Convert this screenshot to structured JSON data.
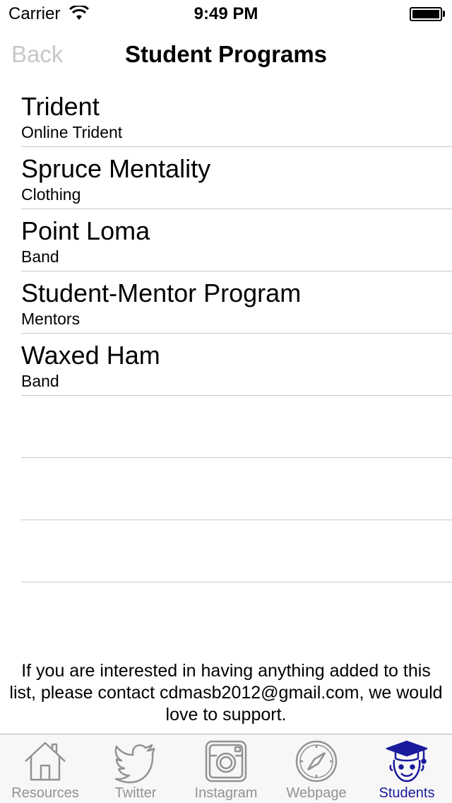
{
  "status_bar": {
    "carrier": "Carrier",
    "time": "9:49 PM",
    "battery_level": 1.0
  },
  "nav_bar": {
    "back_label": "Back",
    "title": "Student Programs"
  },
  "programs": [
    {
      "name": "Trident",
      "subtitle": "Online Trident"
    },
    {
      "name": "Spruce Mentality",
      "subtitle": "Clothing"
    },
    {
      "name": "Point Loma",
      "subtitle": "Band"
    },
    {
      "name": "Student-Mentor Program",
      "subtitle": "Mentors"
    },
    {
      "name": "Waxed Ham",
      "subtitle": "Band"
    }
  ],
  "footer_note": "If you are interested in having anything added to this list, please contact cdmasb2012@gmail.com, we would love to support.",
  "tab_bar": {
    "active_color": "#1a1a9c",
    "inactive_color": "#929292",
    "tabs": [
      {
        "label": "Resources",
        "icon": "house-icon",
        "active": false
      },
      {
        "label": "Twitter",
        "icon": "twitter-bird-icon",
        "active": false
      },
      {
        "label": "Instagram",
        "icon": "instagram-camera-icon",
        "active": false
      },
      {
        "label": "Webpage",
        "icon": "compass-icon",
        "active": false
      },
      {
        "label": "Students",
        "icon": "graduate-cap-icon",
        "active": true
      }
    ]
  }
}
